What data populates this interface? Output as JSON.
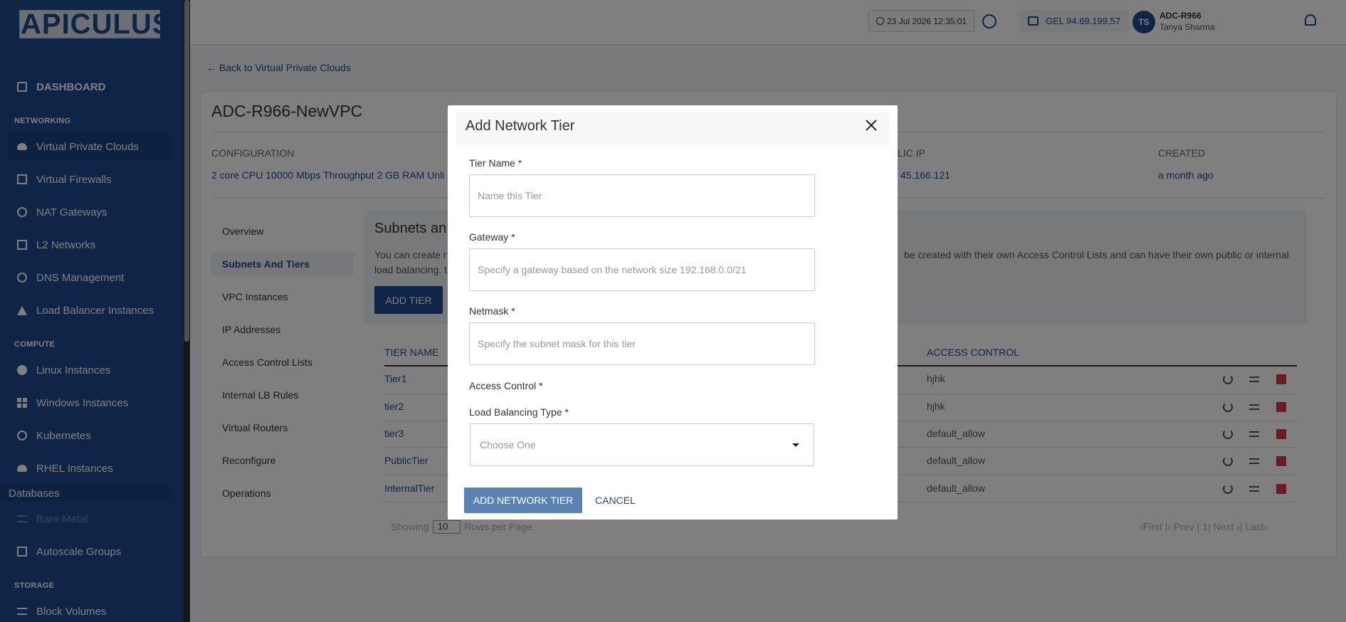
{
  "sidebar": {
    "logo": "APICULUS",
    "dashboard": "DASHBOARD",
    "sections": {
      "networking": "NETWORKING",
      "compute": "COMPUTE",
      "databases": "Databases",
      "storage": "STORAGE"
    },
    "networking_items": [
      "Virtual Private Clouds",
      "Virtual Firewalls",
      "NAT Gateways",
      "L2 Networks",
      "DNS Management",
      "Load Balancer Instances"
    ],
    "compute_items": [
      "Linux Instances",
      "Windows Instances",
      "Kubernetes",
      "RHEL Instances"
    ],
    "bare_metal": "Bare Metal",
    "autoscale": "Autoscale Groups",
    "block_volumes": "Block Volumes"
  },
  "topbar": {
    "datetime": "23 Jul 2026 12:35:01",
    "balance": "GEL 94.69.199,57",
    "avatar_initials": "TS",
    "account": "ADC-R966",
    "user": "Tanya Sharma"
  },
  "content": {
    "back_link": "Back to Virtual Private Clouds",
    "vpc_name": "ADC-R966-NewVPC",
    "configuration_label": "CONFIGURATION",
    "configuration_value": "2 core CPU 10000 Mbps Throughput 2 GB RAM Unli",
    "public_ip_label": "LIC IP",
    "public_ip_value": "45.166.121",
    "created_label": "CREATED",
    "created_value": "a month ago",
    "nav": [
      "Overview",
      "Subnets And Tiers",
      "VPC Instances",
      "IP Addresses",
      "Access Control Lists",
      "Internal LB Rules",
      "Virtual Routers",
      "Reconfigure",
      "Operations"
    ],
    "subnets_title": "Subnets an",
    "subnets_desc_left": "You can create r",
    "subnets_desc_right": "be created with their own Access Control Lists and can have their own public or internal",
    "subnets_desc_line2": "load balancing. t",
    "add_tier": "ADD TIER",
    "table": {
      "col_name": "TIER NAME",
      "col_access": "ACCESS CONTROL",
      "rows": [
        {
          "name": "Tier1",
          "access": "hjhk"
        },
        {
          "name": "tier2",
          "access": "hjhk"
        },
        {
          "name": "tier3",
          "access": "default_allow"
        },
        {
          "name": "PublicTier",
          "access": "default_allow"
        },
        {
          "name": "InternalTier",
          "access": "default_allow"
        }
      ]
    },
    "pager": {
      "showing": "Showing",
      "per_page": "10",
      "rows_per_page": "Rows per Page",
      "nav": "‹First  |‹ Prev  |  1|  Next ›|  Last›"
    }
  },
  "modal": {
    "title": "Add Network Tier",
    "tier_name_label": "Tier Name *",
    "tier_name_placeholder": "Name this Tier",
    "gateway_label": "Gateway *",
    "gateway_placeholder": "Specify a gateway based on the network size 192.168.0.0/21",
    "netmask_label": "Netmask *",
    "netmask_placeholder": "Specify the subnet mask for this tier",
    "access_control_label": "Access Control *",
    "lb_type_label": "Load Balancing Type *",
    "lb_type_value": "Choose One",
    "submit": "ADD NETWORK TIER",
    "cancel": "CANCEL"
  }
}
